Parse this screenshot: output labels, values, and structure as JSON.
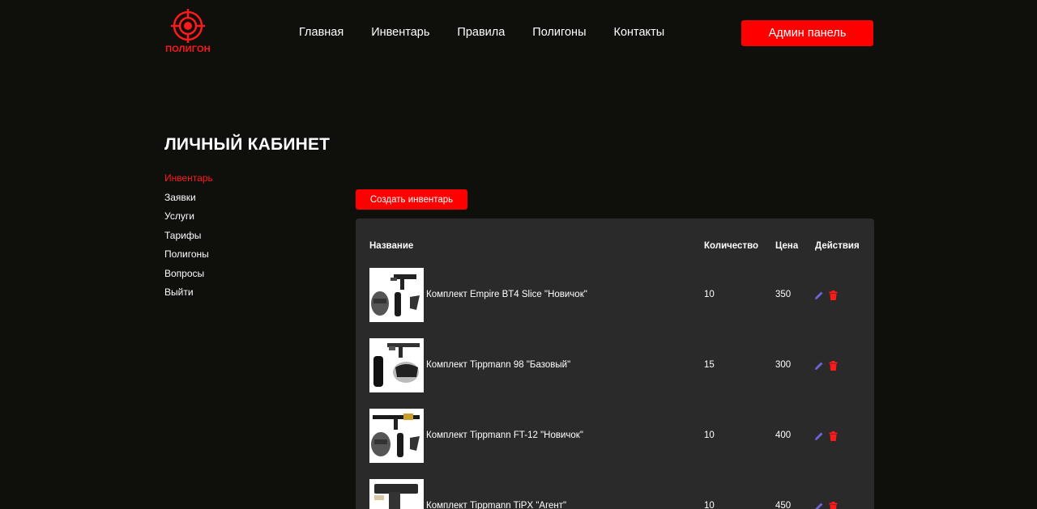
{
  "header": {
    "logo_text": "ПОЛИГОН",
    "nav": [
      {
        "label": "Главная"
      },
      {
        "label": "Инвентарь"
      },
      {
        "label": "Правила"
      },
      {
        "label": "Полигоны"
      },
      {
        "label": "Контакты"
      }
    ],
    "admin_button": "Админ панель"
  },
  "sidebar": {
    "title": "ЛИЧНЫЙ КАБИНЕТ",
    "items": [
      {
        "label": "Инвентарь",
        "active": true
      },
      {
        "label": "Заявки"
      },
      {
        "label": "Услуги"
      },
      {
        "label": "Тарифы"
      },
      {
        "label": "Полигоны"
      },
      {
        "label": "Вопросы"
      },
      {
        "label": "Выйти"
      }
    ]
  },
  "main": {
    "create_button": "Создать инвентарь",
    "columns": {
      "name": "Название",
      "qty": "Количество",
      "price": "Цена",
      "actions": "Действия"
    },
    "rows": [
      {
        "name": "Комплект Empire BT4 Slice \"Новичок\"",
        "qty": "10",
        "price": "350"
      },
      {
        "name": "Комплект Tippmann 98 \"Базовый\"",
        "qty": "15",
        "price": "300"
      },
      {
        "name": "Комплект Tippmann FT-12 \"Новичок\"",
        "qty": "10",
        "price": "400"
      },
      {
        "name": "Комплект Tippmann TiPX \"Агент\"",
        "qty": "10",
        "price": "450"
      }
    ]
  },
  "colors": {
    "background": "#0f0f0c",
    "accent": "#ff0000",
    "card": "#2a2a2b",
    "edit_icon": "#6c63d9",
    "delete_icon": "#ff1a1a"
  },
  "icons": {
    "logo": "target-icon",
    "edit": "pencil-icon",
    "delete": "trash-icon"
  }
}
